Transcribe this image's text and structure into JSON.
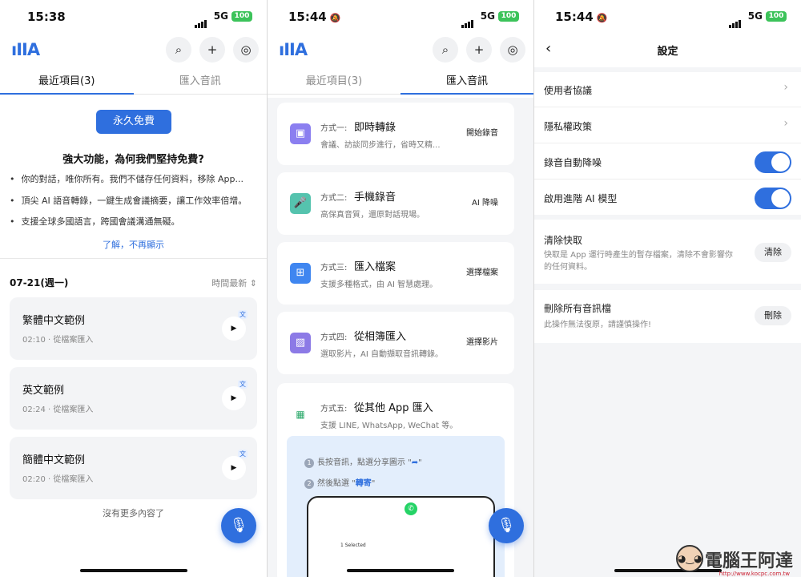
{
  "status_bars": [
    {
      "time": "15:38",
      "network": "5G",
      "battery": "100"
    },
    {
      "time": "15:44",
      "network": "5G",
      "battery": "100"
    },
    {
      "time": "15:44",
      "network": "5G",
      "battery": "100"
    }
  ],
  "app_logo": "ıIIA",
  "header_icons": [
    "search-icon",
    "plus-icon",
    "record-settings-icon"
  ],
  "tabs": {
    "recent": "最近項目(3)",
    "import": "匯入音訊"
  },
  "recent": {
    "free_button": "永久免費",
    "promo_title": "強大功能，為何我們堅持免費?",
    "bullets": [
      "你的對話，唯你所有。我們不儲存任何資料，移除 App...",
      "頂尖 AI 語音轉錄，一鍵生成會議摘要，讓工作效率倍增。",
      "支援全球多國語言，跨國會議溝通無礙。"
    ],
    "dismiss_link": "了解，不再顯示",
    "date_group": "07-21(週一)",
    "sort_label": "時間最新",
    "items": [
      {
        "title": "繁體中文範例",
        "meta": "02:10 · 從檔案匯入",
        "badge": "文"
      },
      {
        "title": "英文範例",
        "meta": "02:24 · 從檔案匯入",
        "badge": "文"
      },
      {
        "title": "簡體中文範例",
        "meta": "02:20 · 從檔案匯入",
        "badge": "文"
      }
    ],
    "no_more": "沒有更多內容了"
  },
  "import_methods": [
    {
      "prefix": "方式一:",
      "name": "即時轉錄",
      "desc": "會議、訪談同步進行，省時又精...",
      "button": "開始錄音",
      "icon": "screen-record-icon",
      "color": "#8b7ff0"
    },
    {
      "prefix": "方式二:",
      "name": "手機錄音",
      "desc": "高保真音質，還原對話現場。",
      "button": "AI 降噪",
      "icon": "microphone-icon",
      "color": "#55c3ae"
    },
    {
      "prefix": "方式三:",
      "name": "匯入檔案",
      "desc": "支援多種格式，由 AI 智慧處理。",
      "button": "選擇檔案",
      "icon": "file-import-icon",
      "color": "#3f86f0"
    },
    {
      "prefix": "方式四:",
      "name": "從相簿匯入",
      "desc": "選取影片，AI 自動擷取音訊轉錄。",
      "button": "選擇影片",
      "icon": "photo-album-icon",
      "color": "#8c7ae6"
    },
    {
      "prefix": "方式五:",
      "name": "從其他 App 匯入",
      "desc": "支援 LINE, WhatsApp, WeChat 等。",
      "icon": "messaging-apps-icon"
    }
  ],
  "guide": {
    "step1_text": "長按音訊，點選分享圖示 \"",
    "step1_end": "\"",
    "step2_text": "然後點選 \"",
    "step2_bold": "轉寄",
    "step2_end": "\"",
    "phone_selected": "1 Selected"
  },
  "settings": {
    "title": "設定",
    "links": [
      "使用者協議",
      "隱私權政策"
    ],
    "toggles": [
      {
        "label": "錄音自動降噪",
        "on": true
      },
      {
        "label": "啟用進階 AI 模型",
        "on": true
      }
    ],
    "clear_cache": {
      "title": "清除快取",
      "desc": "快取是 App 運行時產生的暫存檔案，清除不會影響你的任何資料。",
      "button": "清除"
    },
    "delete_all": {
      "title": "刪除所有音訊檔",
      "desc": "此操作無法復原，請謹慎操作!",
      "button": "刪除"
    }
  },
  "watermark": {
    "text": "電腦王阿達",
    "url": "http://www.kocpc.com.tw"
  },
  "colors": {
    "accent": "#2f6fde",
    "battery": "#3cc35a"
  }
}
